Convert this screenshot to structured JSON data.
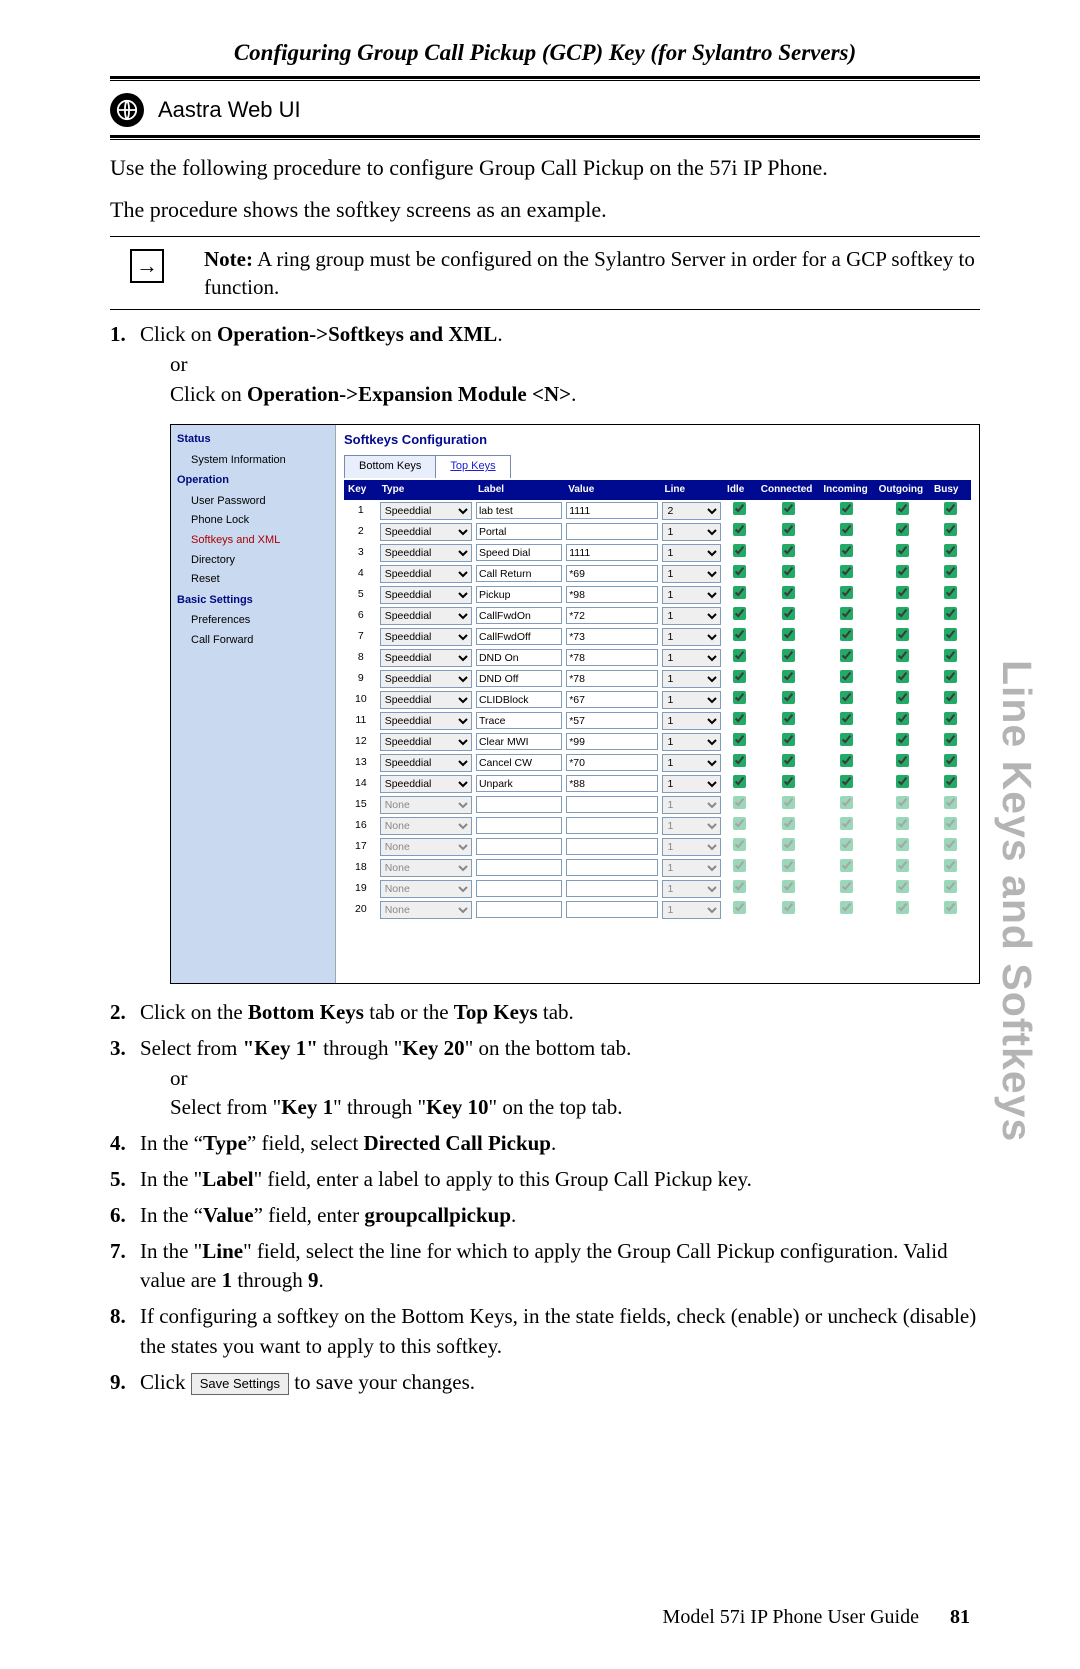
{
  "page_header": "Configuring Group Call Pickup (GCP) Key (for Sylantro Servers)",
  "section_label": "Aastra Web UI",
  "intro1": "Use the following procedure to configure Group Call Pickup on the 57i IP Phone.",
  "intro2": "The procedure shows the softkey screens as an example.",
  "note_label": "Note:",
  "note_text": " A ring group must be configured on the Sylantro Server in order for a GCP softkey to function.",
  "step1_a": "Click on ",
  "step1_b": "Operation->Softkeys and XML",
  "step1_or": "or",
  "step1_c": "Click on ",
  "step1_d": "Operation->Expansion Module <N>",
  "sidebar": {
    "status": "Status",
    "sysinfo": "System Information",
    "operation": "Operation",
    "userpw": "User Password",
    "phonelock": "Phone Lock",
    "softkeys": "Softkeys and XML",
    "directory": "Directory",
    "reset": "Reset",
    "basic": "Basic Settings",
    "prefs": "Preferences",
    "callfwd": "Call Forward"
  },
  "cfg_title": "Softkeys Configuration",
  "tab_bottom": "Bottom Keys",
  "tab_top": "Top Keys",
  "cols": {
    "key": "Key",
    "type": "Type",
    "label": "Label",
    "value": "Value",
    "line": "Line",
    "idle": "Idle",
    "connected": "Connected",
    "incoming": "Incoming",
    "outgoing": "Outgoing",
    "busy": "Busy"
  },
  "rows": [
    {
      "k": "1",
      "type": "Speeddial",
      "label": "lab test",
      "value": "1111",
      "line": "2",
      "on": true
    },
    {
      "k": "2",
      "type": "Speeddial",
      "label": "Portal",
      "value": "",
      "line": "1",
      "on": true
    },
    {
      "k": "3",
      "type": "Speeddial",
      "label": "Speed Dial",
      "value": "1111",
      "line": "1",
      "on": true
    },
    {
      "k": "4",
      "type": "Speeddial",
      "label": "Call Return",
      "value": "*69",
      "line": "1",
      "on": true
    },
    {
      "k": "5",
      "type": "Speeddial",
      "label": "Pickup",
      "value": "*98",
      "line": "1",
      "on": true
    },
    {
      "k": "6",
      "type": "Speeddial",
      "label": "CallFwdOn",
      "value": "*72",
      "line": "1",
      "on": true
    },
    {
      "k": "7",
      "type": "Speeddial",
      "label": "CallFwdOff",
      "value": "*73",
      "line": "1",
      "on": true
    },
    {
      "k": "8",
      "type": "Speeddial",
      "label": "DND On",
      "value": "*78",
      "line": "1",
      "on": true
    },
    {
      "k": "9",
      "type": "Speeddial",
      "label": "DND Off",
      "value": "*78",
      "line": "1",
      "on": true
    },
    {
      "k": "10",
      "type": "Speeddial",
      "label": "CLIDBlock",
      "value": "*67",
      "line": "1",
      "on": true
    },
    {
      "k": "11",
      "type": "Speeddial",
      "label": "Trace",
      "value": "*57",
      "line": "1",
      "on": true
    },
    {
      "k": "12",
      "type": "Speeddial",
      "label": "Clear MWI",
      "value": "*99",
      "line": "1",
      "on": true
    },
    {
      "k": "13",
      "type": "Speeddial",
      "label": "Cancel CW",
      "value": "*70",
      "line": "1",
      "on": true
    },
    {
      "k": "14",
      "type": "Speeddial",
      "label": "Unpark",
      "value": "*88",
      "line": "1",
      "on": true
    },
    {
      "k": "15",
      "type": "None",
      "label": "",
      "value": "",
      "line": "1",
      "on": false
    },
    {
      "k": "16",
      "type": "None",
      "label": "",
      "value": "",
      "line": "1",
      "on": false
    },
    {
      "k": "17",
      "type": "None",
      "label": "",
      "value": "",
      "line": "1",
      "on": false
    },
    {
      "k": "18",
      "type": "None",
      "label": "",
      "value": "",
      "line": "1",
      "on": false
    },
    {
      "k": "19",
      "type": "None",
      "label": "",
      "value": "",
      "line": "1",
      "on": false
    },
    {
      "k": "20",
      "type": "None",
      "label": "",
      "value": "",
      "line": "1",
      "on": false
    }
  ],
  "step2_a": "Click on the ",
  "step2_b": "Bottom Keys",
  "step2_c": " tab or the ",
  "step2_d": "Top Keys",
  "step2_e": " tab.",
  "step3_a": "Select from ",
  "step3_b": "\"Key 1\"",
  "step3_c": " through \"",
  "step3_d": "Key 20",
  "step3_e": "\" on the bottom tab.",
  "step3_or": "or",
  "step3_f": "Select from \"",
  "step3_g": "Key 1",
  "step3_h": "\" through \"",
  "step3_i": "Key 10",
  "step3_j": "\" on the top tab.",
  "step4_a": "In the “",
  "step4_b": "Type",
  "step4_c": "” field, select ",
  "step4_d": "Directed Call Pickup",
  "step4_e": ".",
  "step5_a": "In the \"",
  "step5_b": "Label",
  "step5_c": "\" field, enter a label to apply to this Group Call Pickup key.",
  "step6_a": "In the “",
  "step6_b": "Value",
  "step6_c": "” field, enter ",
  "step6_d": "groupcallpickup",
  "step6_e": ".",
  "step7_a": "In the \"",
  "step7_b": "Line",
  "step7_c": "\" field, select the line for which to apply the Group Call Pickup configuration. Valid value are ",
  "step7_d": "1",
  "step7_e": " through ",
  "step7_f": "9",
  "step7_g": ".",
  "step8": "If configuring a softkey on the Bottom Keys, in the state fields, check (enable) or uncheck (disable) the states you want to apply to this softkey.",
  "step9_a": "Click ",
  "step9_btn": "Save Settings",
  "step9_b": " to save your changes.",
  "side_tab": "Line Keys and Softkeys",
  "footer_text": "Model 57i IP Phone User Guide",
  "footer_page": "81"
}
